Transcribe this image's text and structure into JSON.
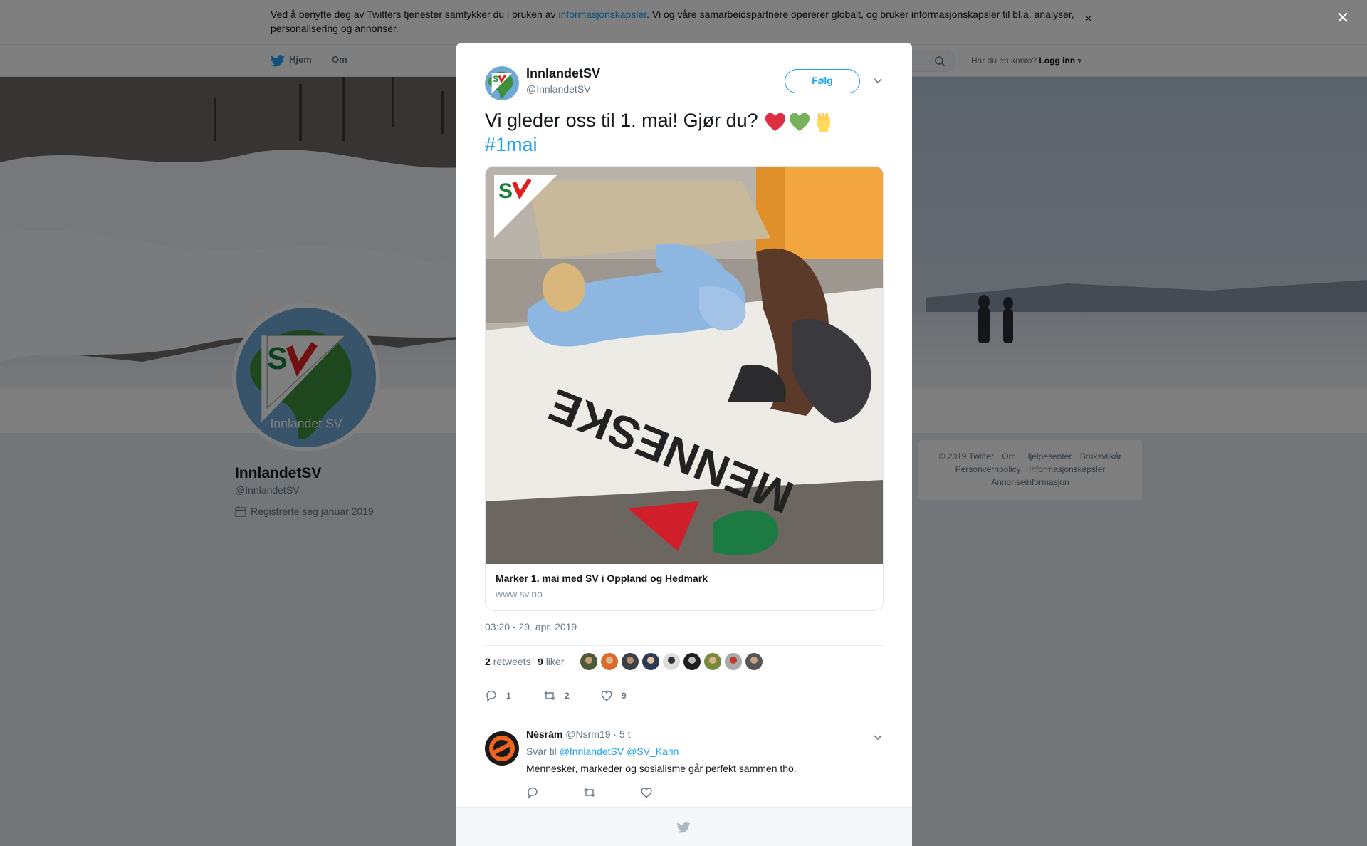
{
  "cookie_banner": {
    "text_before": "Ved å benytte deg av Twitters tjenester samtykker du i bruken av ",
    "link": "informasjonskapsler",
    "text_after": ". Vi og våre samarbeidspartnere opererer globalt, og bruker informasjonskapsler til bl.a. analyser, personalisering og annonser.",
    "close": "×"
  },
  "topnav": {
    "home": "Hjem",
    "about": "Om",
    "account_prompt": "Har du en konto?",
    "login": "Logg inn"
  },
  "profile": {
    "name": "InnlandetSV",
    "handle": "@InnlandetSV",
    "joined": "Registrerte seg januar 2019",
    "avatar_caption": "Innlandet SV"
  },
  "footer": {
    "links_row1": [
      "© 2019 Twitter",
      "Om",
      "Hjelpesenter",
      "Bruksvilkår"
    ],
    "links_row2": [
      "Personvernpolicy",
      "Informasjonskapsler"
    ],
    "links_row3": [
      "Annonseinformasjon"
    ]
  },
  "overlay_close": "×",
  "tweet": {
    "author_name": "InnlandetSV",
    "author_handle": "@InnlandetSV",
    "follow_label": "Følg",
    "text": "Vi gleder oss til 1. mai! Gjør du? ",
    "hashtag": "#1mai",
    "card": {
      "title": "Marker 1. mai med SV i Oppland og Hedmark",
      "domain": "www.sv.no"
    },
    "timestamp": "03:20 - 29. apr. 2019",
    "retweets_count": "2",
    "retweets_label": "retweets",
    "likes_count": "9",
    "likes_label": "liker",
    "reply_count": "1",
    "retweet_count": "2",
    "like_count": "9"
  },
  "reply": {
    "name": "Nésrám",
    "handle": "@Nsrm19",
    "time": "· 5 t",
    "reply_to_label": "Svar til",
    "mention1": "@InnlandetSV",
    "mention2": "@SV_Karin",
    "text": "Mennesker, markeder og sosialisme går perfekt sammen tho."
  },
  "colors": {
    "accent": "#1da1f2",
    "sv_red": "#e02020",
    "sv_green": "#17803c"
  }
}
